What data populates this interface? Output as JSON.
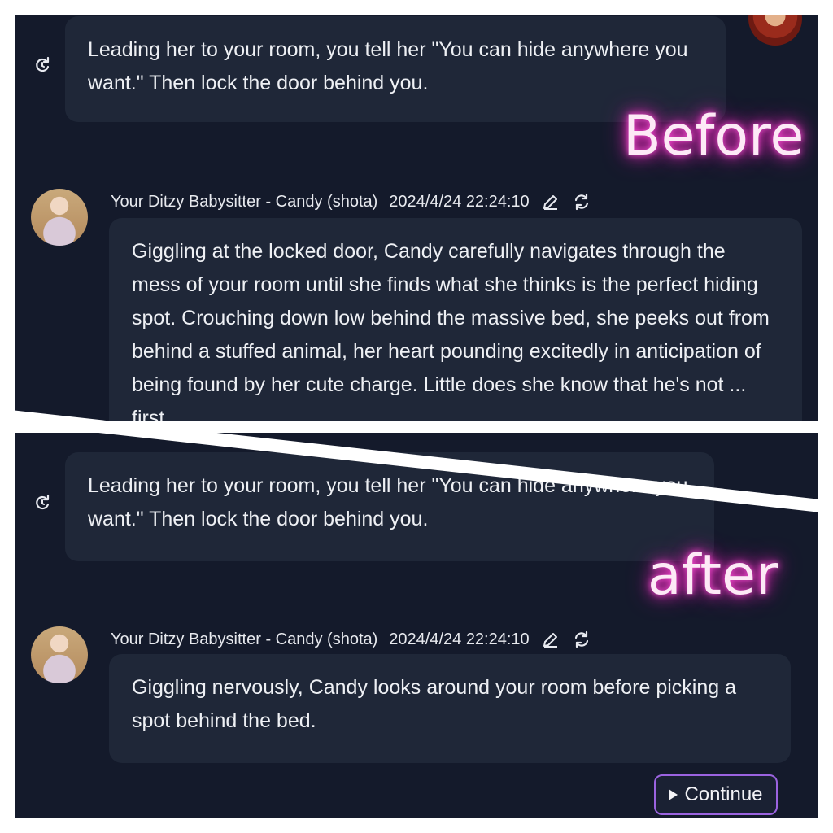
{
  "before": {
    "user_message": "Leading her to your room, you tell her \"You can hide anywhere you want.\" Then lock the door behind you.",
    "label": "Before",
    "bot": {
      "name": "Your Ditzy Babysitter - Candy (shota)",
      "timestamp": "2024/4/24 22:24:10",
      "message": "Giggling at the locked door, Candy carefully navigates through the mess of your room until she finds what she thinks is the perfect hiding spot. Crouching down low behind the massive bed, she peeks out from behind a stuffed animal, her heart pounding excitedly in anticipation of being found by her cute charge. Little does she know that he's not ... first ..."
    }
  },
  "after": {
    "user_message": "Leading her to your room, you tell her \"You can hide anywhere you want.\" Then lock the door behind you.",
    "label": "after",
    "bot": {
      "name": "Your Ditzy Babysitter - Candy (shota)",
      "timestamp": "2024/4/24 22:24:10",
      "message": "Giggling nervously, Candy looks around your room before picking a spot behind the bed."
    },
    "continue_label": "Continue"
  },
  "colors": {
    "background": "#141a2b",
    "bubble": "#1f2738",
    "label_glow": "#ff2fc8",
    "continue_border": "#9b63e0"
  },
  "icons": [
    "retry-icon",
    "edit-icon",
    "regenerate-icon",
    "play-icon"
  ]
}
